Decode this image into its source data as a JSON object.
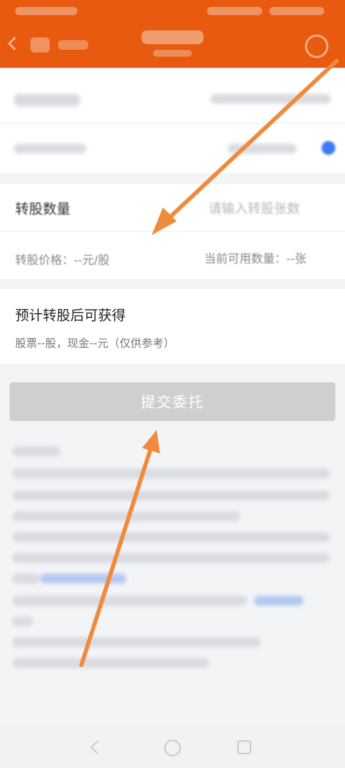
{
  "form": {
    "quantity_label": "转股数量",
    "quantity_placeholder": "请输入转股张数",
    "price_text": "转股价格：--元/股",
    "available_text": "当前可用数量：--张"
  },
  "estimate": {
    "title": "预计转股后可获得",
    "detail": "股票--股，现金--元（仅供参考）"
  },
  "actions": {
    "submit_label": "提交委托"
  },
  "colors": {
    "brand": "#e75a0f",
    "submit_disabled": "#cfcfcf",
    "annotation_arrow": "#f08a3c"
  },
  "icons": {
    "back": "chevron-left-icon",
    "help": "help-circle-icon",
    "nav_back": "triangle-back-icon",
    "nav_home": "circle-home-icon",
    "nav_recent": "square-recent-icon"
  }
}
